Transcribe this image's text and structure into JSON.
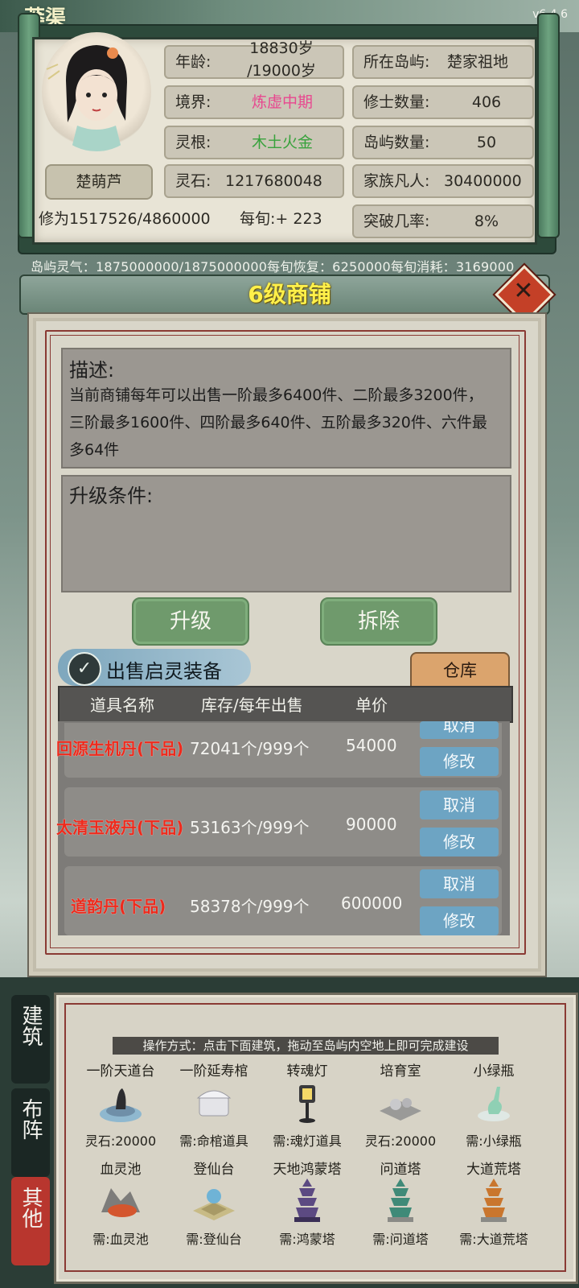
{
  "header": {
    "corner_tag": "莽渠",
    "version": "v6.4.6"
  },
  "player": {
    "name": "楚萌芦",
    "age_label": "年龄:",
    "age_value_line1": "18830岁",
    "age_value_line2": "/19000岁",
    "realm_label": "境界:",
    "realm_value": "炼虚中期",
    "root_label": "灵根:",
    "root_value": "木土火金",
    "stones_label": "灵石:",
    "stones_value": "1217680048",
    "cultivation_text": "修为1517526/4860000",
    "per_turn_text": "每旬:+ 223",
    "island_label": "所在岛屿:",
    "island_value": "楚家祖地",
    "cultivators_label": "修士数量:",
    "cultivators_value": "406",
    "islands_label": "岛屿数量:",
    "islands_value": "50",
    "mortals_label": "家族凡人:",
    "mortals_value": "30400000",
    "breakthrough_label": "突破几率:",
    "breakthrough_value": "8%"
  },
  "qi_line": "岛屿灵气：1875000000/1875000000每旬恢复：6250000每旬消耗：3169000",
  "shop": {
    "title": "6级商铺",
    "desc_title": "描述:",
    "desc_text": "当前商铺每年可以出售一阶最多6400件、二阶最多3200件，三阶最多1600件、四阶最多640件、五阶最多320件、六件最多64件",
    "req_title": "升级条件:",
    "upgrade_label": "升级",
    "demolish_label": "拆除",
    "sell_toggle_label": "出售启灵装备",
    "warehouse_label": "仓库",
    "columns": [
      "道具名称",
      "库存/每年出售",
      "单价"
    ],
    "rows": [
      {
        "name": "回源生机丹(下品)",
        "stock": "72041个/999个",
        "price": "54000",
        "cancel": "取消",
        "edit": "修改"
      },
      {
        "name": "太清玉液丹(下品)",
        "stock": "53163个/999个",
        "price": "90000",
        "cancel": "取消",
        "edit": "修改"
      },
      {
        "name": "道韵丹(下品)",
        "stock": "58378个/999个",
        "price": "600000",
        "cancel": "取消",
        "edit": "修改"
      }
    ]
  },
  "side_tabs": [
    "建筑",
    "布阵",
    "其他"
  ],
  "build": {
    "hint": "操作方式：点击下面建筑，拖动至岛屿内空地上即可完成建设",
    "items": [
      {
        "name": "一阶天道台",
        "cost": "灵石:20000"
      },
      {
        "name": "一阶延寿棺",
        "cost": "需:命棺道具"
      },
      {
        "name": "转魂灯",
        "cost": "需:魂灯道具"
      },
      {
        "name": "培育室",
        "cost": "灵石:20000"
      },
      {
        "name": "小绿瓶",
        "cost": "需:小绿瓶"
      },
      {
        "name": "血灵池",
        "cost": "需:血灵池"
      },
      {
        "name": "登仙台",
        "cost": "需:登仙台"
      },
      {
        "name": "天地鸿蒙塔",
        "cost": "需:鸿蒙塔"
      },
      {
        "name": "问道塔",
        "cost": "需:问道塔"
      },
      {
        "name": "大道荒塔",
        "cost": "需:大道荒塔"
      }
    ]
  },
  "colors": {
    "realm": "#e8478f",
    "root": "#38a23c",
    "item_name": "#ee2a1c",
    "title": "#fff04a"
  }
}
